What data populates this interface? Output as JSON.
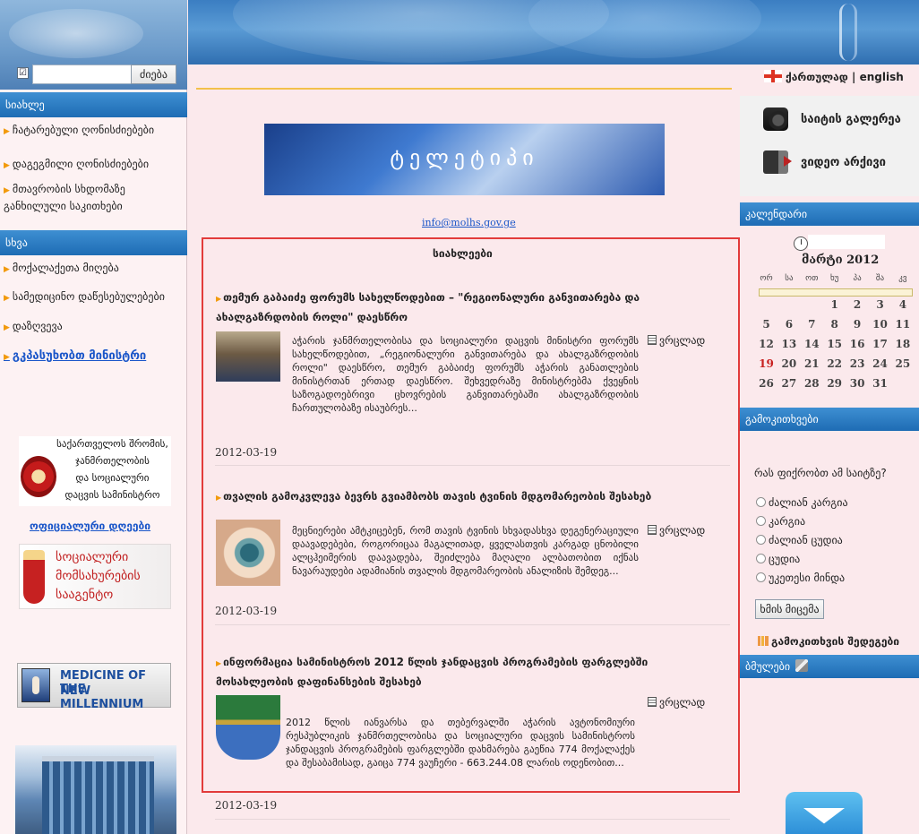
{
  "search": {
    "checkbox_mark": "☑",
    "placeholder": "",
    "button": "ძიება"
  },
  "left": {
    "section_news": "სიახლე",
    "news_items": [
      "ჩატარებული ღონისძიებები",
      "დაგეგმილი ღონისძიებები",
      "მთავრობის სხდომაზე\nგანხილული საკითხები"
    ],
    "section_other": "სხვა",
    "other_items": [
      "მოქალაქეთა მიღება",
      "სამედიცინო დაწესებულებები",
      "დაზღვევა",
      "გკპასუხობთ მინისტრი"
    ],
    "ministry_logo_lines": [
      "საქართველოს შრომის,",
      "ჯანმრთელობის",
      "და სოციალური",
      "დაცვის სამინისტრო"
    ],
    "official_link": "ოფიციალური დღეები",
    "agency_logo_lines": [
      "სოციალური",
      "მომსახურების",
      "სააგენტო"
    ],
    "medicine_banner_lines": [
      "MEDICINE OF THE",
      "NEW MILLENNIUM"
    ]
  },
  "center": {
    "banner_text": "ტელეტიპი",
    "email": "info@molhs.gov.ge",
    "news_title": "სიახლეები",
    "news": [
      {
        "title": "თემურ გაბაიძე ფორუმს სახელწოდებით – \"რეგიონალური განვითარება და ახალგაზრდობის როლი\" დაესწრო",
        "text": "აჭარის ჯანმრთელობისა და სოციალური დაცვის მინისტრი ფორუმს სახელწოდებით, „რეგიონალური განვითარება და ახალგაზრდობის როლი\" დაესწრო, თემურ გაბაიძე ფორუმს აჭარის განათლების მინისტრთან ერთად დაესწრო. შეხვედრაზე მინისტრებმა ქვეყნის საზოგადოებრივი ცხოვრების განვითარებაში ახალგაზრდობის ჩართულობაზე ისაუბრეს...",
        "more": "ვრცლად",
        "date": "2012-03-19"
      },
      {
        "title": "თვალის გამოკვლევა ბევრს გვიამბობს თავის ტვინის მდგომარეობის შესახებ",
        "text": "მეცნიერები ამტკიცებენ, რომ თავის ტვინის სხვადასხვა დეგენერაციული დაავადებები, როგორიცაა მაგალითად, ყველასთვის კარგად ცნობილი ალცჰეიმერის დაავადება, შეიძლება მაღალი ალბათობით იქნას ნავარაუდები ადამიანის თვალის მდგომარეობის ანალიზის შემდეგ...",
        "more": "ვრცლად",
        "date": "2012-03-19"
      },
      {
        "title": "ინფორმაცია სამინისტროს 2012 წლის ჯანდაცვის პროგრამების ფარგლებში მოსახლეობის დაფინანსების შესახებ",
        "text": "2012 წლის იანვარსა და თებერვალში აჭარის ავტონომიური რესპუბლიკის ჯანმრთელობისა და სოციალური დაცვის სამინისტროს ჯანდაცვის პროგრამების ფარგლებში დახმარება გაეწია 774 მოქალაქეს და შესაბამისად, გაიცა 774 ვაუჩერი - 663.244.08 ლარის ოდენობით...",
        "more": "ვრცლად",
        "date": "2012-03-19"
      }
    ]
  },
  "right": {
    "lang_ka": "ქართულად",
    "lang_sep": "|",
    "lang_en": "english",
    "gallery": "საიტის გალერეა",
    "video": "ვიდეო არქივი",
    "calendar_head": "კალენდარი",
    "calendar_month": "მარტი 2012",
    "calendar_dayheads": [
      "ორ",
      "სა",
      "ოთ",
      "ხუ",
      "პა",
      "შა",
      "კვ"
    ],
    "calendar_days": [
      [
        "",
        "",
        "",
        "1",
        "2",
        "3",
        "4"
      ],
      [
        "5",
        "6",
        "7",
        "8",
        "9",
        "10",
        "11"
      ],
      [
        "12",
        "13",
        "14",
        "15",
        "16",
        "17",
        "18"
      ],
      [
        "19",
        "20",
        "21",
        "22",
        "23",
        "24",
        "25"
      ],
      [
        "26",
        "27",
        "28",
        "29",
        "30",
        "31",
        ""
      ]
    ],
    "today": "19",
    "poll_head": "გამოკითხვები",
    "poll_question": "რას ფიქრობთ ამ საიტზე?",
    "poll_options": [
      "ძალიან კარგია",
      "კარგია",
      "ძალიან ცუდია",
      "ცუდია",
      "უკეთესი მინდა"
    ],
    "vote_button": "ხმის მიცემა",
    "poll_results": "გამოკითხვის შედეგები",
    "links_head": "ბმულები"
  },
  "colors": {
    "accent_blue": "#1e6cb4",
    "news_border": "#e23b3b",
    "bullet": "#f29a0c",
    "today": "#c8201f",
    "background": "#fbe9ec"
  }
}
